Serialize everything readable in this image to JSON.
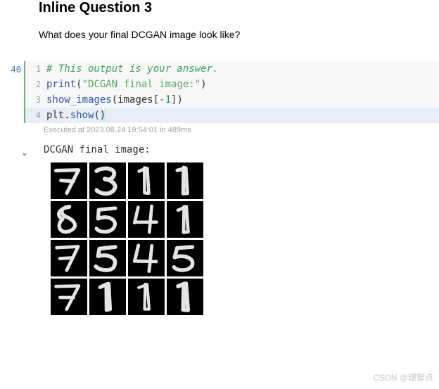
{
  "heading": "Inline Question 3",
  "question": "What does your final DCGAN image look like?",
  "cell": {
    "exec_count": "40",
    "code_lines": [
      {
        "n": "1",
        "tokens": [
          [
            "comment",
            "# This output is your answer."
          ]
        ]
      },
      {
        "n": "2",
        "tokens": [
          [
            "func",
            "print"
          ],
          [
            "punc",
            "("
          ],
          [
            "str",
            "\"DCGAN final image:\""
          ],
          [
            "punc",
            ")"
          ]
        ]
      },
      {
        "n": "3",
        "tokens": [
          [
            "call",
            "show_images"
          ],
          [
            "punc",
            "("
          ],
          [
            "obj",
            "images"
          ],
          [
            "punc",
            "["
          ],
          [
            "num",
            "-1"
          ],
          [
            "punc",
            "]"
          ],
          [
            "punc",
            ")"
          ]
        ]
      },
      {
        "n": "4",
        "tokens": [
          [
            "obj",
            "plt"
          ],
          [
            "punc",
            "."
          ],
          [
            "call",
            "show"
          ],
          [
            "punc",
            "("
          ],
          [
            "cursor",
            ")"
          ]
        ]
      }
    ],
    "exec_meta": "Executed at 2023.08.24 19:54:01 in 489ms"
  },
  "output": {
    "text": "DCGAN final image:",
    "collapse_glyph": "⌄",
    "grid": [
      [
        "7",
        "3",
        "1",
        "1"
      ],
      [
        "8",
        "5",
        "4",
        "1"
      ],
      [
        "7",
        "5",
        "4",
        "5"
      ],
      [
        "7",
        "1",
        "1",
        "1"
      ]
    ]
  },
  "watermark": "CSDN @理智点"
}
